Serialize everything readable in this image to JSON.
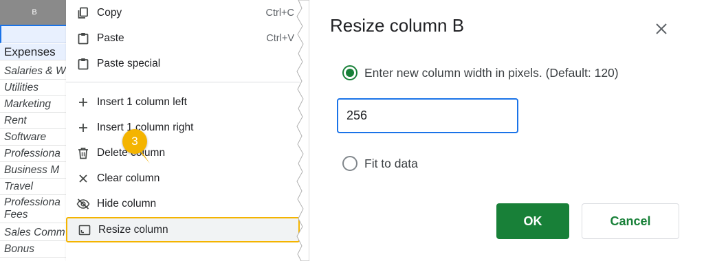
{
  "sheet": {
    "column_letter": "B",
    "cells": [
      "Expenses",
      "Salaries & W",
      "Utilities",
      "Marketing",
      "Rent",
      "Software",
      "Professiona",
      "Business M",
      "Travel",
      "Professiona Fees",
      "Sales Comm",
      "Bonus"
    ]
  },
  "menu": {
    "items": [
      {
        "label": "Copy",
        "shortcut": "Ctrl+C",
        "icon": "copy-icon"
      },
      {
        "label": "Paste",
        "shortcut": "Ctrl+V",
        "icon": "paste-icon"
      },
      {
        "label": "Paste special",
        "icon": "paste-special-icon"
      },
      {
        "label": "Insert 1 column left",
        "icon": "plus-icon"
      },
      {
        "label": "Insert 1 column right",
        "icon": "plus-icon"
      },
      {
        "label": "Delete column",
        "icon": "trash-icon"
      },
      {
        "label": "Clear column",
        "icon": "close-icon"
      },
      {
        "label": "Hide column",
        "icon": "eye-off-icon"
      },
      {
        "label": "Resize column",
        "icon": "resize-icon"
      }
    ]
  },
  "callout": {
    "number": "3",
    "color": "#f4b400"
  },
  "dialog": {
    "title": "Resize column B",
    "option_pixels_label": "Enter new column width in pixels. (Default: 120)",
    "width_value": "256",
    "option_fit_label": "Fit to data",
    "ok_label": "OK",
    "cancel_label": "Cancel",
    "accent_color": "#188038"
  }
}
